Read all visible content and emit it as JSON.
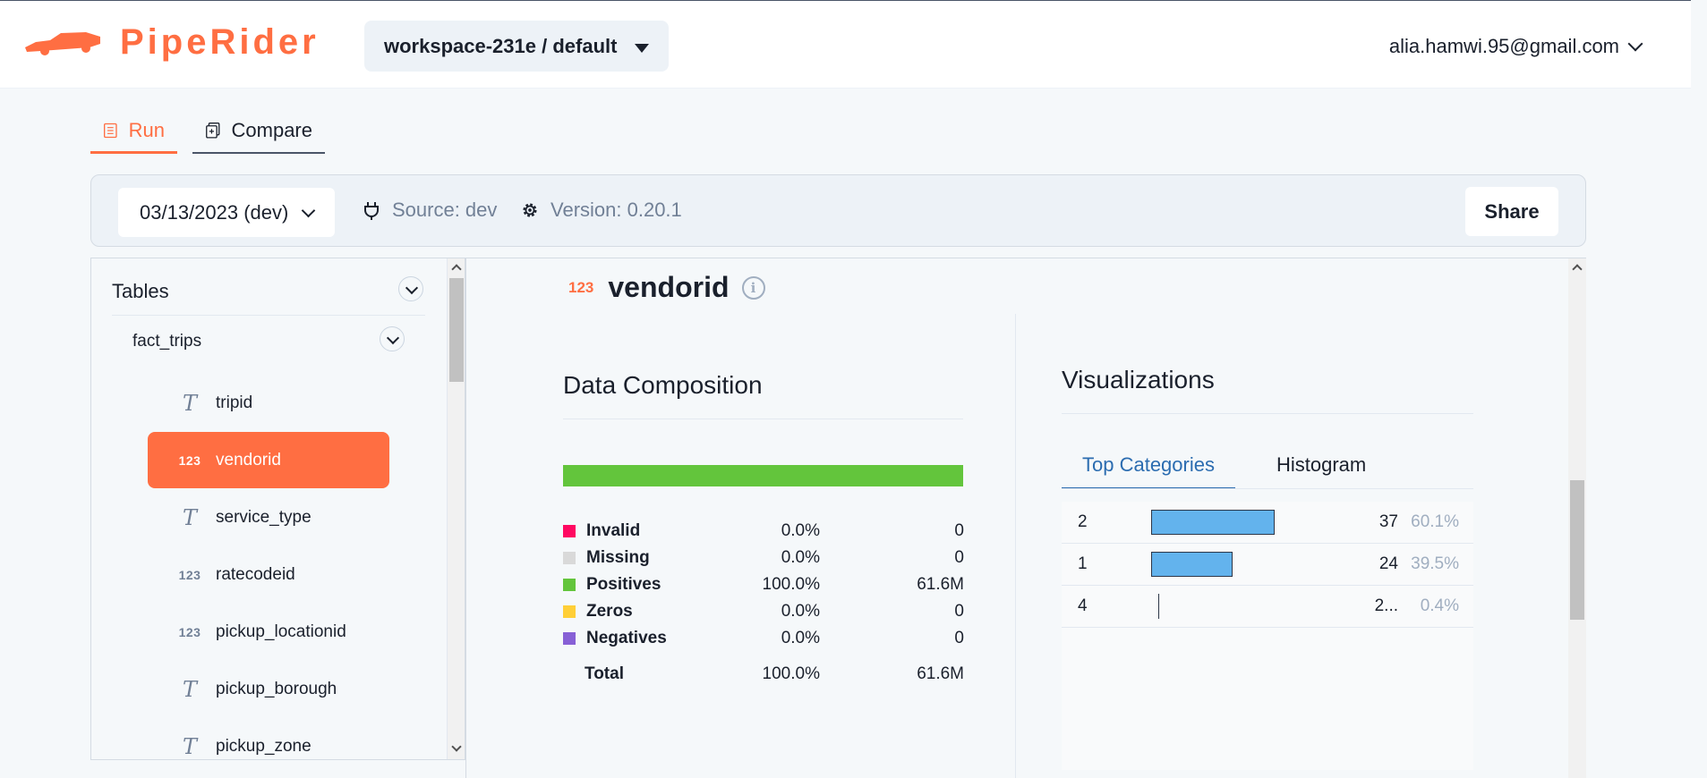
{
  "header": {
    "logo_text": "PipeRider",
    "workspace": "workspace-231e / default",
    "user_email": "alia.hamwi.95@gmail.com"
  },
  "tabs": [
    {
      "label": "Run",
      "active": true
    },
    {
      "label": "Compare",
      "active": false
    }
  ],
  "runbar": {
    "date": "03/13/2023 (dev)",
    "source": "Source: dev",
    "version": "Version: 0.20.1",
    "share_label": "Share"
  },
  "sidebar": {
    "tables_label": "Tables",
    "table_name": "fact_trips",
    "columns": [
      {
        "name": "tripid",
        "type": "text",
        "active": false
      },
      {
        "name": "vendorid",
        "type": "numeric",
        "active": true
      },
      {
        "name": "service_type",
        "type": "text",
        "active": false
      },
      {
        "name": "ratecodeid",
        "type": "numeric",
        "active": false
      },
      {
        "name": "pickup_locationid",
        "type": "numeric",
        "active": false
      },
      {
        "name": "pickup_borough",
        "type": "text",
        "active": false
      },
      {
        "name": "pickup_zone",
        "type": "text",
        "active": false
      }
    ],
    "icon_text": {
      "text": "T",
      "numeric": "123"
    }
  },
  "column_detail": {
    "type_icon": "123",
    "name": "vendorid",
    "info_icon": "i"
  },
  "data_composition": {
    "title": "Data Composition",
    "rows": [
      {
        "label": "Invalid",
        "pct": "0.0%",
        "count": "0",
        "color": "#ff0861",
        "fraction": 0.0
      },
      {
        "label": "Missing",
        "pct": "0.0%",
        "count": "0",
        "color": "#d9d9d9",
        "fraction": 0.0
      },
      {
        "label": "Positives",
        "pct": "100.0%",
        "count": "61.6M",
        "color": "#63c53c",
        "fraction": 1.0
      },
      {
        "label": "Zeros",
        "pct": "0.0%",
        "count": "0",
        "color": "#ffcf37",
        "fraction": 0.0
      },
      {
        "label": "Negatives",
        "pct": "0.0%",
        "count": "0",
        "color": "#8760d6",
        "fraction": 0.0
      }
    ],
    "total": {
      "label": "Total",
      "pct": "100.0%",
      "count": "61.6M"
    }
  },
  "visualizations": {
    "title": "Visualizations",
    "tabs": [
      "Top Categories",
      "Histogram"
    ],
    "top_categories": [
      {
        "key": "2",
        "count": "37",
        "pct": "60.1%",
        "fraction": 0.601
      },
      {
        "key": "1",
        "count": "24",
        "pct": "39.5%",
        "fraction": 0.395
      },
      {
        "key": "4",
        "count": "2...",
        "pct": "0.4%",
        "fraction": 0.004
      }
    ]
  }
}
